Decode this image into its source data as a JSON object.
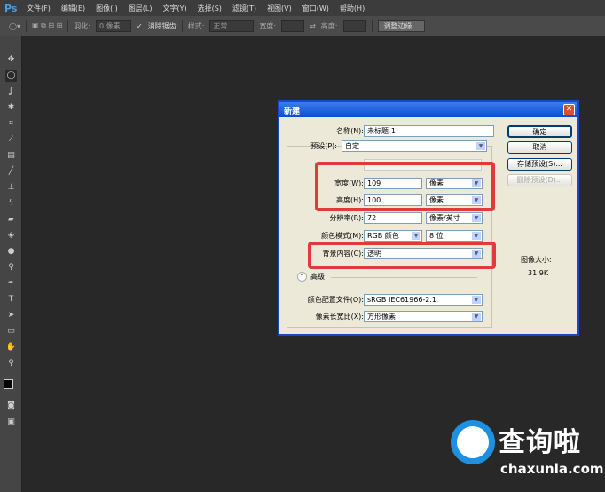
{
  "app": {
    "logo": "Ps"
  },
  "menu": [
    "文件(F)",
    "编辑(E)",
    "图像(I)",
    "图层(L)",
    "文字(Y)",
    "选择(S)",
    "滤镜(T)",
    "视图(V)",
    "窗口(W)",
    "帮助(H)"
  ],
  "options": {
    "feather_label": "羽化:",
    "feather_value": "0 像素",
    "antialias": "消除锯齿",
    "style_label": "样式:",
    "style_value": "正常",
    "width_label": "宽度:",
    "height_label": "高度:",
    "refine_button": "调整边缘..."
  },
  "dialog": {
    "title": "新建",
    "name_label": "名称(N):",
    "name_value": "未标题-1",
    "preset_label": "预设(P):",
    "preset_value": "自定",
    "width_label": "宽度(W):",
    "width_value": "109",
    "width_unit": "像素",
    "height_label": "高度(H):",
    "height_value": "100",
    "height_unit": "像素",
    "resolution_label": "分辨率(R):",
    "resolution_value": "72",
    "resolution_unit": "像素/英寸",
    "mode_label": "颜色模式(M):",
    "mode_value": "RGB 颜色",
    "depth_value": "8 位",
    "bg_label": "背景内容(C):",
    "bg_value": "透明",
    "advanced_label": "高级",
    "profile_label": "颜色配置文件(O):",
    "profile_value": "sRGB IEC61966-2.1",
    "aspect_label": "像素长宽比(X):",
    "aspect_value": "方形像素",
    "ok": "确定",
    "cancel": "取消",
    "save_preset": "存储预设(S)...",
    "delete_preset": "删除预设(D)...",
    "image_size_label": "图像大小:",
    "image_size_value": "31.9K"
  },
  "watermark": {
    "brand": "查询啦",
    "url": "chaxunla.com"
  }
}
